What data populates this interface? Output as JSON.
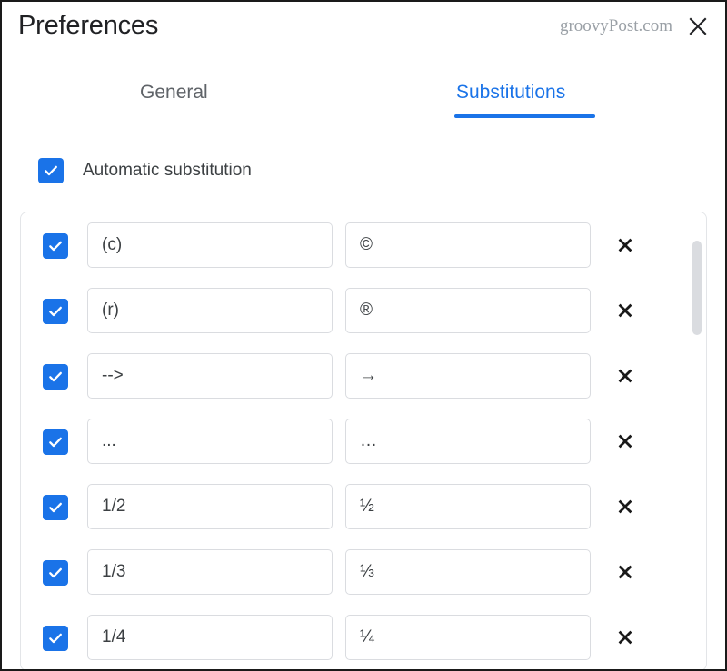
{
  "header": {
    "title": "Preferences",
    "watermark": "groovyPost.com",
    "close_label": "×",
    "close_icon": "close-icon"
  },
  "tabs": [
    {
      "label": "General",
      "active": false
    },
    {
      "label": "Substitutions",
      "active": true
    }
  ],
  "master_toggle": {
    "label": "Automatic substitution",
    "checked": true,
    "check_icon": "checkmark-icon"
  },
  "colors": {
    "accent": "#1a73e8",
    "text_primary": "#202124",
    "text_secondary": "#5f6368",
    "field_border": "#dadce0",
    "panel_border": "#e3e5e8",
    "scrollbar_thumb": "#dadce0",
    "watermark": "#9aa0a6"
  },
  "substitutions": {
    "delete_icon": "close-x-icon",
    "rows": [
      {
        "checked": true,
        "shortcut": "(c)",
        "replacement": "©"
      },
      {
        "checked": true,
        "shortcut": "(r)",
        "replacement": "®"
      },
      {
        "checked": true,
        "shortcut": "-->",
        "replacement": "→"
      },
      {
        "checked": true,
        "shortcut": "...",
        "replacement": "…"
      },
      {
        "checked": true,
        "shortcut": "1/2",
        "replacement": "½"
      },
      {
        "checked": true,
        "shortcut": "1/3",
        "replacement": "⅓"
      },
      {
        "checked": true,
        "shortcut": "1/4",
        "replacement": "¼"
      }
    ]
  },
  "scrollbar": {
    "orientation": "vertical",
    "thumb_position_percent": 5
  }
}
